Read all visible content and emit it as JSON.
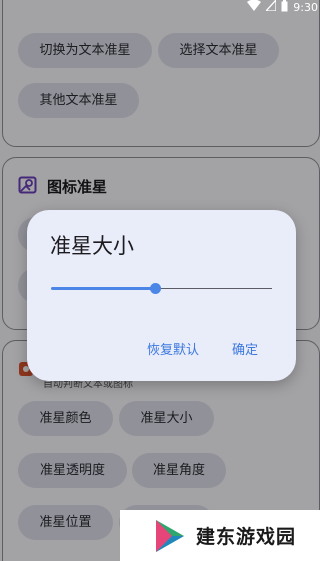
{
  "status_bar": {
    "time": "9:30"
  },
  "text_section": {
    "chips": [
      "切换为文本准星",
      "选择文本准星",
      "其他文本准星"
    ]
  },
  "icon_section": {
    "title": "图标准星"
  },
  "custom_section": {
    "subtitle": "自动判断文本或图标",
    "chips": [
      "准星颜色",
      "准星大小",
      "准星透明度",
      "准星角度",
      "准星位置"
    ]
  },
  "dialog": {
    "title": "准星大小",
    "slider_value": 0.47,
    "reset_label": "恢复默认",
    "confirm_label": "确定"
  },
  "watermark": {
    "text": "建东游戏园"
  },
  "colors": {
    "accent": "#4b86e6",
    "dialog_bg": "#e9ecf9",
    "chip_bg": "#dcdde9"
  }
}
